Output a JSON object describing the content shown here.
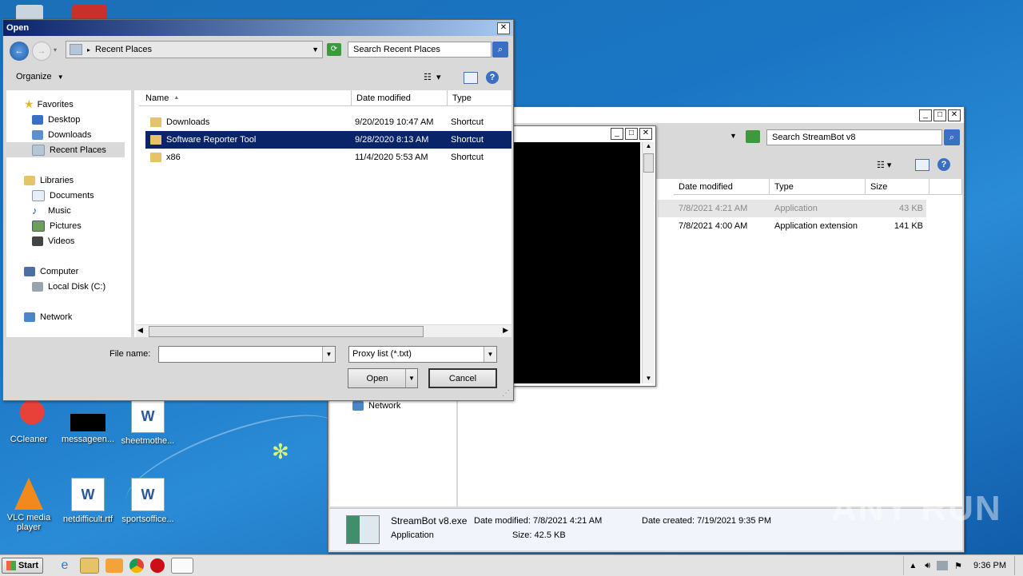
{
  "desktop": {
    "icons": [
      {
        "label": "CCleaner"
      },
      {
        "label": "messageen..."
      },
      {
        "label": "sheetmothe..."
      },
      {
        "label": "VLC media player"
      },
      {
        "label": "netdifficult.rtf"
      },
      {
        "label": "sportsoffice..."
      }
    ]
  },
  "bg_window": {
    "search_placeholder": "Search StreamBot v8",
    "columns": [
      "Date modified",
      "Type",
      "Size"
    ],
    "rows": [
      {
        "date": "7/8/2021 4:21 AM",
        "type": "Application",
        "size": "43 KB"
      },
      {
        "date": "7/8/2021 4:00 AM",
        "type": "Application extension",
        "size": "141 KB"
      }
    ],
    "nav_network": "Network",
    "details": {
      "name": "StreamBot v8.exe",
      "kind": "Application",
      "date_modified_label": "Date modified:",
      "date_modified": "7/8/2021 4:21 AM",
      "size_label": "Size:",
      "size": "42.5 KB",
      "date_created_label": "Date created:",
      "date_created": "7/19/2021 9:35 PM"
    }
  },
  "dialog": {
    "title": "Open",
    "address": "Recent Places",
    "search_placeholder": "Search Recent Places",
    "organize_label": "Organize",
    "nav": {
      "favorites": "Favorites",
      "desktop": "Desktop",
      "downloads": "Downloads",
      "recent_places": "Recent Places",
      "libraries": "Libraries",
      "documents": "Documents",
      "music": "Music",
      "pictures": "Pictures",
      "videos": "Videos",
      "computer": "Computer",
      "local_disk": "Local Disk (C:)",
      "network": "Network"
    },
    "columns": [
      "Name",
      "Date modified",
      "Type"
    ],
    "files": [
      {
        "name": "Downloads",
        "date": "9/20/2019 10:47 AM",
        "type": "Shortcut"
      },
      {
        "name": "Software Reporter Tool",
        "date": "9/28/2020 8:13 AM",
        "type": "Shortcut"
      },
      {
        "name": "x86",
        "date": "11/4/2020 5:53 AM",
        "type": "Shortcut"
      }
    ],
    "file_name_label": "File name:",
    "file_name_value": "",
    "filter": "Proxy list (*.txt)",
    "open_label": "Open",
    "cancel_label": "Cancel"
  },
  "taskbar": {
    "start_label": "Start",
    "clock": "9:36 PM"
  },
  "watermark": "ANY RUN"
}
